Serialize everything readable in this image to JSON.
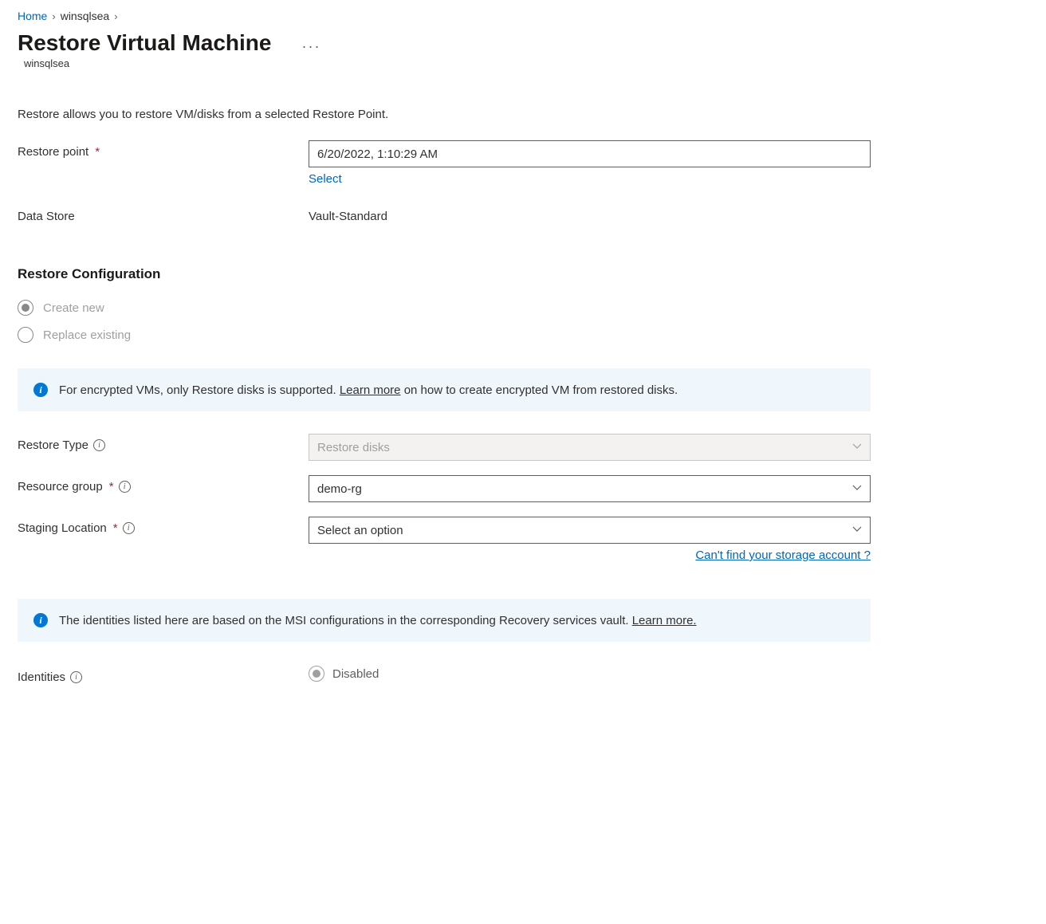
{
  "breadcrumb": {
    "home": "Home",
    "current": "winsqlsea"
  },
  "page": {
    "title": "Restore Virtual Machine",
    "subtitle": "winsqlsea",
    "intro": "Restore allows you to restore VM/disks from a selected Restore Point."
  },
  "fields": {
    "restorePoint": {
      "label": "Restore point",
      "value": "6/20/2022, 1:10:29 AM",
      "selectLink": "Select"
    },
    "dataStore": {
      "label": "Data Store",
      "value": "Vault-Standard"
    },
    "restoreType": {
      "label": "Restore Type",
      "value": "Restore disks"
    },
    "resourceGroup": {
      "label": "Resource group",
      "value": "demo-rg"
    },
    "stagingLocation": {
      "label": "Staging Location",
      "placeholder": "Select an option",
      "helpLink": "Can't find your storage account ?"
    },
    "identities": {
      "label": "Identities",
      "value": "Disabled"
    }
  },
  "section": {
    "restoreConfig": "Restore Configuration"
  },
  "radios": {
    "createNew": "Create new",
    "replaceExisting": "Replace existing"
  },
  "infoBars": {
    "encrypted": {
      "pre": "For encrypted VMs, only Restore disks is supported. ",
      "link": "Learn more",
      "post": " on how to create encrypted VM from restored disks."
    },
    "identities": {
      "pre": "The identities listed here are based on the MSI configurations in the corresponding Recovery services vault. ",
      "link": "Learn more."
    }
  }
}
